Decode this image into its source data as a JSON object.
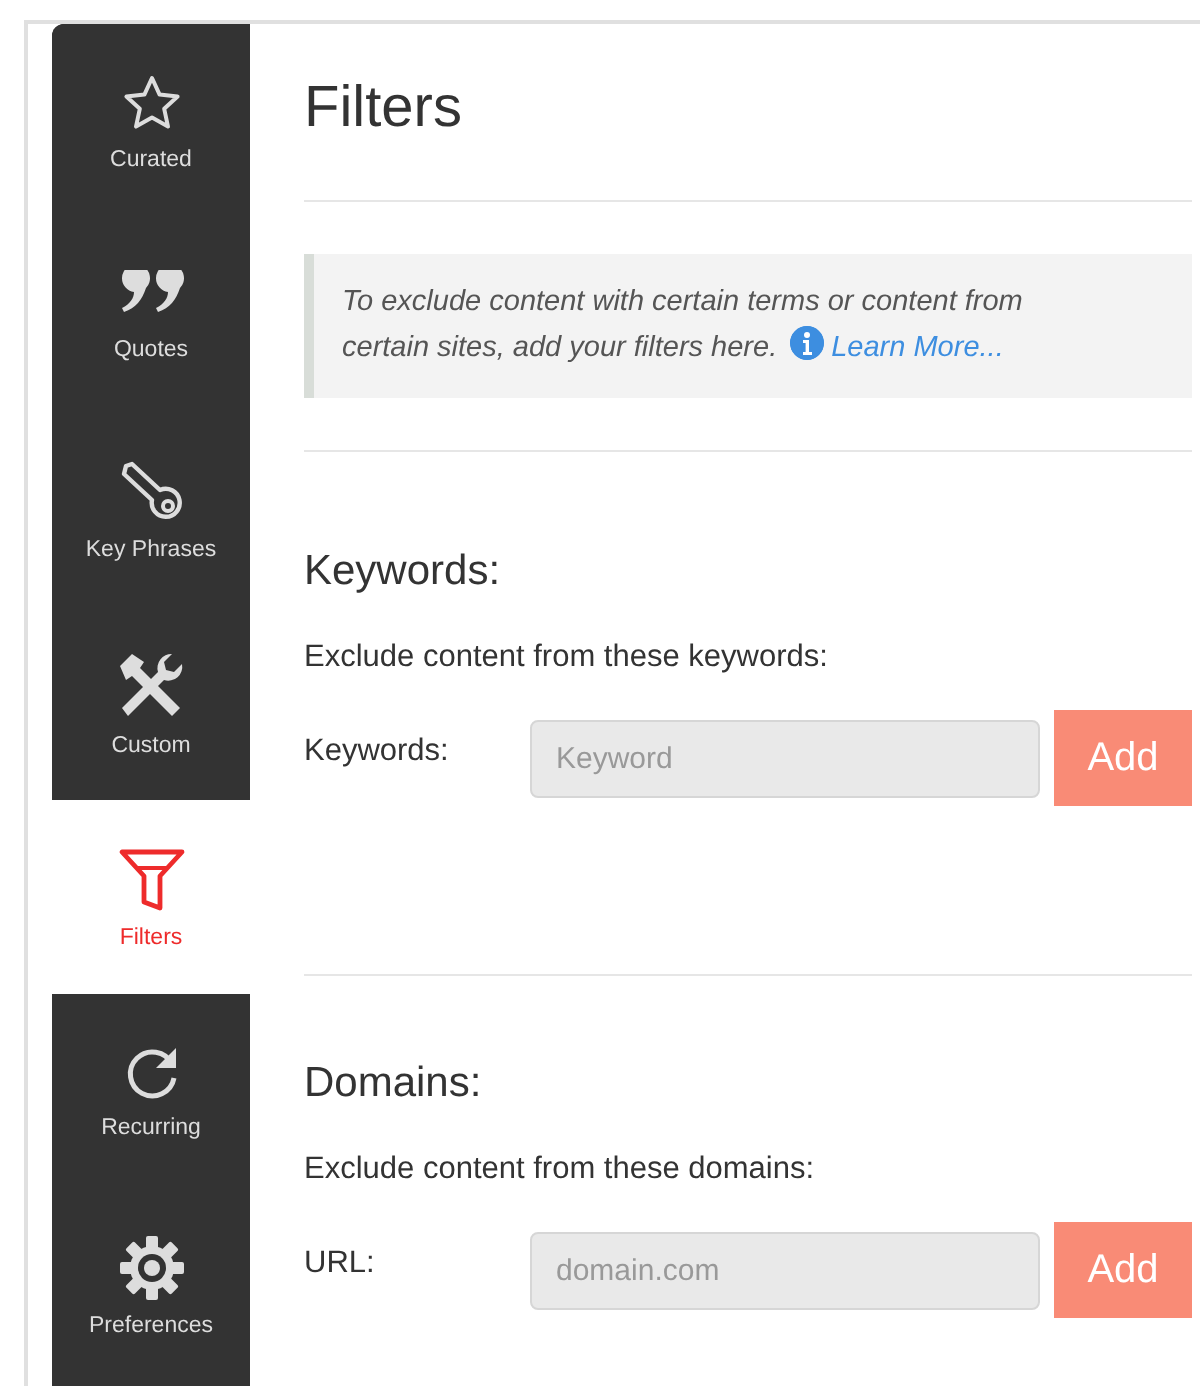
{
  "sidebar": {
    "items": [
      {
        "kind": "star",
        "label": "Curated",
        "selected": false
      },
      {
        "kind": "quote",
        "label": "Quotes",
        "selected": false
      },
      {
        "kind": "key",
        "label": "Key Phrases",
        "selected": false
      },
      {
        "kind": "tools",
        "label": "Custom",
        "selected": false
      },
      {
        "kind": "funnel",
        "label": "Filters",
        "selected": true
      },
      {
        "kind": "refresh",
        "label": "Recurring",
        "selected": false
      },
      {
        "kind": "gear",
        "label": "Preferences",
        "selected": false
      }
    ]
  },
  "page_title": "Filters",
  "note": {
    "text": "To exclude content with certain terms or content from certain sites, add your filters here.",
    "link": "Learn More..."
  },
  "sections": [
    {
      "heading": "Keywords:",
      "description": "Exclude content from these keywords:",
      "field_label": "Keywords:",
      "placeholder": "Keyword",
      "button": "Add"
    },
    {
      "heading": "Domains:",
      "description": "Exclude content from these domains:",
      "field_label": "URL:",
      "placeholder": "domain.com",
      "button": "Add"
    }
  ]
}
